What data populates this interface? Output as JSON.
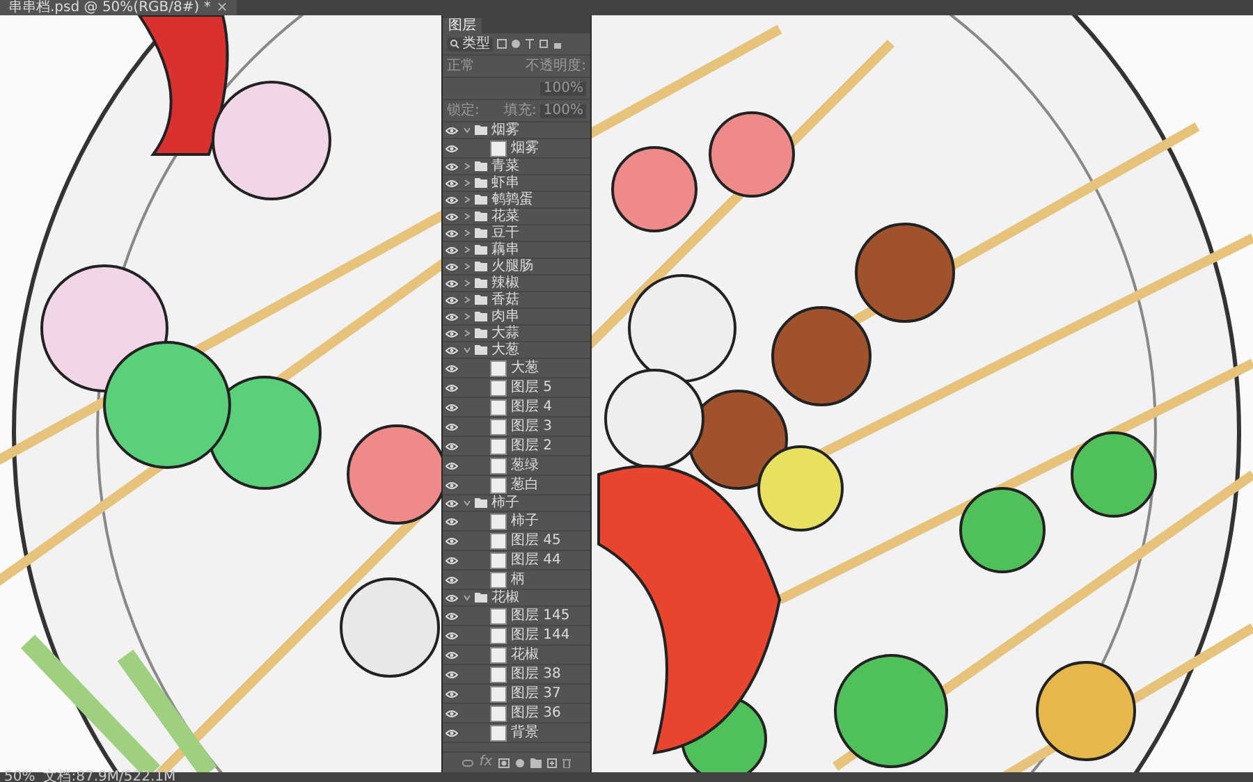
{
  "document_tab": {
    "title": "串串档.psd @ 50%(RGB/8#) *",
    "close": "×"
  },
  "layers_panel": {
    "tab": "图层",
    "filter": "类型",
    "blend_mode": "正常",
    "opacity_label": "不透明度:",
    "opacity": "100%",
    "lock_label": "锁定:",
    "fill_label": "填充:",
    "fill": "100%",
    "fx": "fx",
    "layers": [
      {
        "name": "烟雾",
        "kind": "group",
        "visible": true,
        "expanded": true,
        "children": [
          {
            "name": "烟雾",
            "kind": "layer",
            "visible": true
          }
        ]
      },
      {
        "name": "青菜",
        "kind": "group",
        "visible": true,
        "expanded": false
      },
      {
        "name": "虾串",
        "kind": "group",
        "visible": true,
        "expanded": false
      },
      {
        "name": "鹌鹑蛋",
        "kind": "group",
        "visible": true,
        "expanded": false
      },
      {
        "name": "花菜",
        "kind": "group",
        "visible": true,
        "expanded": false
      },
      {
        "name": "豆干",
        "kind": "group",
        "visible": true,
        "expanded": false
      },
      {
        "name": "藕串",
        "kind": "group",
        "visible": true,
        "expanded": false
      },
      {
        "name": "火腿肠",
        "kind": "group",
        "visible": true,
        "expanded": false
      },
      {
        "name": "辣椒",
        "kind": "group",
        "visible": true,
        "expanded": false
      },
      {
        "name": "香菇",
        "kind": "group",
        "visible": true,
        "expanded": false
      },
      {
        "name": "肉串",
        "kind": "group",
        "visible": true,
        "expanded": false
      },
      {
        "name": "大蒜",
        "kind": "group",
        "visible": true,
        "expanded": false
      },
      {
        "name": "大葱",
        "kind": "group",
        "visible": true,
        "expanded": true,
        "children": [
          {
            "name": "大葱",
            "kind": "layer",
            "visible": true
          },
          {
            "name": "图层 5",
            "kind": "layer",
            "visible": true
          },
          {
            "name": "图层 4",
            "kind": "layer",
            "visible": true
          },
          {
            "name": "图层 3",
            "kind": "layer",
            "visible": true
          },
          {
            "name": "图层 2",
            "kind": "layer",
            "visible": true
          },
          {
            "name": "葱绿",
            "kind": "layer",
            "visible": true
          },
          {
            "name": "葱白",
            "kind": "layer",
            "visible": true
          }
        ]
      },
      {
        "name": "柿子",
        "kind": "group",
        "visible": true,
        "expanded": true,
        "children": [
          {
            "name": "柿子",
            "kind": "layer",
            "visible": true
          },
          {
            "name": "图层 45",
            "kind": "layer",
            "visible": true
          },
          {
            "name": "图层 44",
            "kind": "layer",
            "visible": true
          },
          {
            "name": "柄",
            "kind": "layer",
            "visible": true
          }
        ]
      },
      {
        "name": "花椒",
        "kind": "group",
        "visible": true,
        "expanded": true,
        "children": [
          {
            "name": "图层 145",
            "kind": "layer",
            "visible": true
          },
          {
            "name": "图层 144",
            "kind": "layer",
            "visible": true
          },
          {
            "name": "花椒",
            "kind": "layer",
            "visible": true
          },
          {
            "name": "图层 38",
            "kind": "layer",
            "visible": true
          },
          {
            "name": "图层 37",
            "kind": "layer",
            "visible": true
          },
          {
            "name": "图层 36",
            "kind": "layer",
            "visible": true
          },
          {
            "name": "背景",
            "kind": "layer",
            "visible": true
          }
        ]
      }
    ]
  },
  "status_bar": {
    "zoom": "50%",
    "document_info": "文档:87.9M/522.1M"
  }
}
